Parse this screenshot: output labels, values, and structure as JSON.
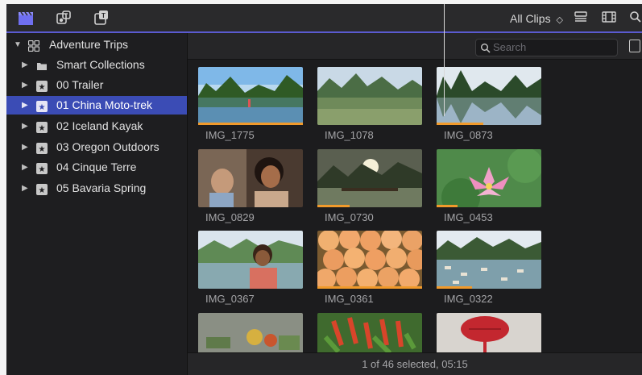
{
  "toolbar": {
    "icons": [
      "libraries-icon",
      "photos-audio-icon",
      "titles-generators-icon"
    ],
    "filter_label": "All Clips",
    "right_icons": [
      "list-view-icon",
      "filmstrip-view-icon",
      "search-icon"
    ]
  },
  "sidebar": {
    "library": "Adventure Trips",
    "items": [
      {
        "label": "Smart Collections",
        "icon": "folder-icon"
      },
      {
        "label": "00 Trailer",
        "icon": "event-star-icon"
      },
      {
        "label": "01 China Moto-trek",
        "icon": "event-star-icon",
        "selected": true
      },
      {
        "label": "02 Iceland Kayak",
        "icon": "event-star-icon"
      },
      {
        "label": "03 Oregon Outdoors",
        "icon": "event-star-icon"
      },
      {
        "label": "04 Cinque Terre",
        "icon": "event-star-icon"
      },
      {
        "label": "05 Bavaria Spring",
        "icon": "event-star-icon"
      }
    ]
  },
  "browser": {
    "search_placeholder": "Search",
    "clips": [
      {
        "name": "IMG_1775",
        "used": 1.0
      },
      {
        "name": "IMG_1078",
        "used": 0
      },
      {
        "name": "IMG_0873",
        "used": 0.45
      },
      {
        "name": "IMG_0829",
        "used": 0
      },
      {
        "name": "IMG_0730",
        "used": 0.3
      },
      {
        "name": "IMG_0453",
        "used": 0.2
      },
      {
        "name": "IMG_0367",
        "used": 0
      },
      {
        "name": "IMG_0361",
        "used": 1.0
      },
      {
        "name": "IMG_0322",
        "used": 0.35
      },
      {
        "name": "",
        "used": 0
      },
      {
        "name": "",
        "used": 0
      },
      {
        "name": "",
        "used": 0
      }
    ],
    "status": "1 of 46 selected, 05:15"
  },
  "colors": {
    "selection": "#3b4cb5",
    "usage_bar": "#f19a2b",
    "accent": "#5a5ad0"
  }
}
